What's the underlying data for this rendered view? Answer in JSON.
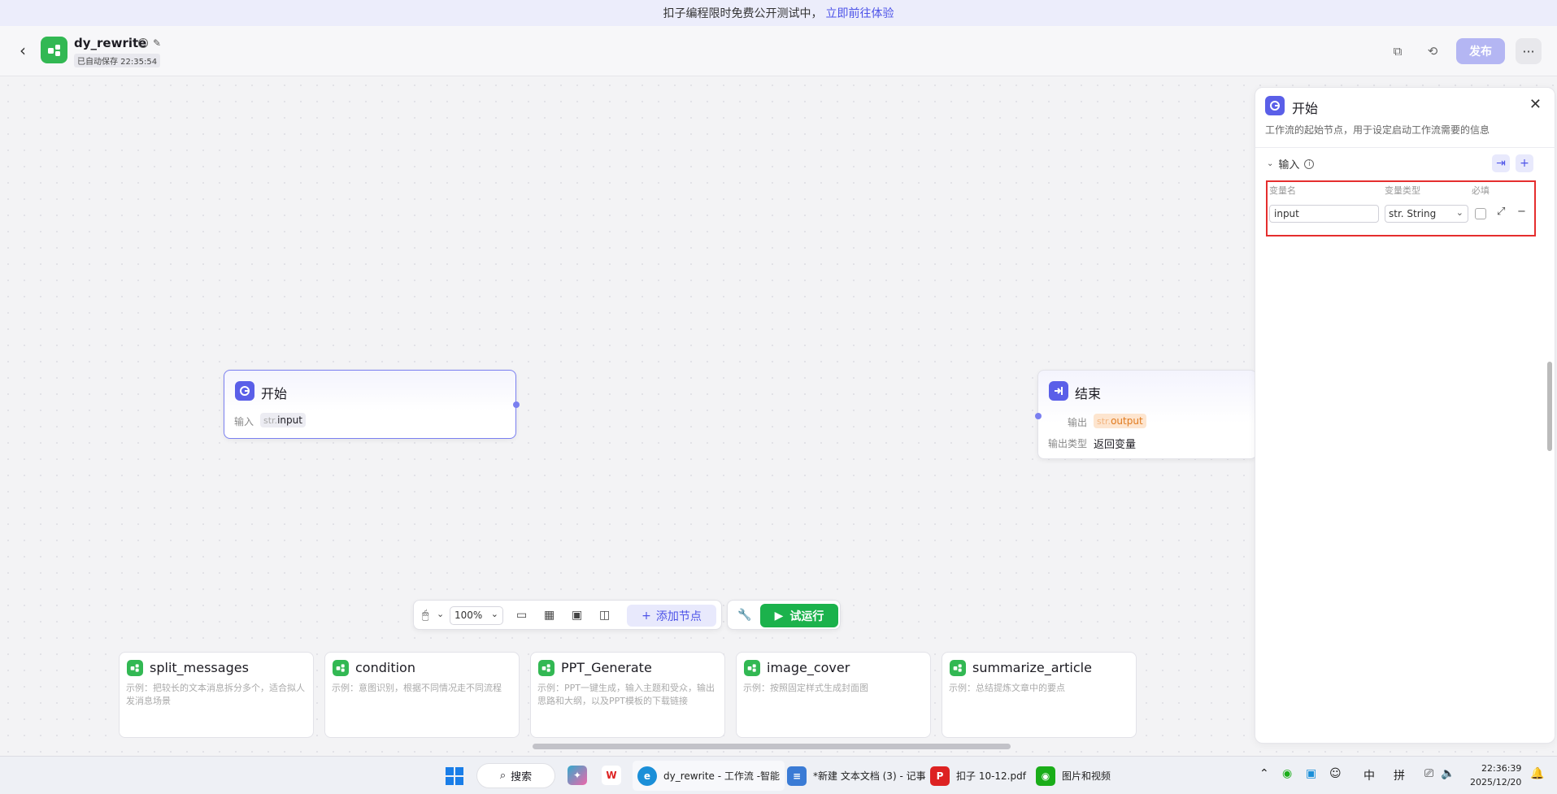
{
  "banner": {
    "text": "扣子编程限时免费公开测试中，",
    "link": "立即前往体验"
  },
  "header": {
    "app_name": "dy_rewrite",
    "saved_status": "已自动保存 22:35:54",
    "publish_label": "发布",
    "more_label": "···"
  },
  "canvas": {
    "start_node": {
      "title": "开始",
      "input_label": "输入",
      "type_tag": "str.",
      "var_name": "input"
    },
    "end_node": {
      "title": "结束",
      "output_label": "输出",
      "type_tag": "str.",
      "var_name": "output",
      "output_type_label": "输出类型",
      "output_type_value": "返回变量"
    }
  },
  "panel": {
    "title": "开始",
    "description": "工作流的起始节点，用于设定启动工作流需要的信息",
    "section_title": "输入",
    "columns": [
      "变量名",
      "变量类型",
      "必填"
    ],
    "row": {
      "name": "input",
      "type": "str. String"
    }
  },
  "toolbar": {
    "zoom": "100%",
    "add_node_label": "添加节点",
    "run_label": "试运行"
  },
  "templates": [
    {
      "title": "split_messages",
      "desc": "示例：把较长的文本消息拆分多个，适合拟人发消息场景"
    },
    {
      "title": "condition",
      "desc": "示例：意图识别，根据不同情况走不同流程"
    },
    {
      "title": "PPT_Generate",
      "desc": "示例：PPT一键生成，输入主题和受众，输出思路和大纲，以及PPT模板的下载链接"
    },
    {
      "title": "image_cover",
      "desc": "示例：按照固定样式生成封面图"
    },
    {
      "title": "summarize_article",
      "desc": "示例：总结提炼文章中的要点"
    }
  ],
  "taskbar": {
    "search_label": "搜索",
    "apps": [
      {
        "label": "dy_rewrite - 工作流 -智能"
      },
      {
        "label": "*新建 文本文档 (3) - 记事"
      },
      {
        "label": "扣子 10-12.pdf"
      },
      {
        "label": "图片和视频"
      }
    ],
    "ime1": "中",
    "ime2": "拼",
    "time": "22:36:39",
    "date": "2025/12/20"
  },
  "colors": {
    "accent": "#4d53e8",
    "green": "#1bb24c",
    "highlight": "#e52e2e"
  }
}
